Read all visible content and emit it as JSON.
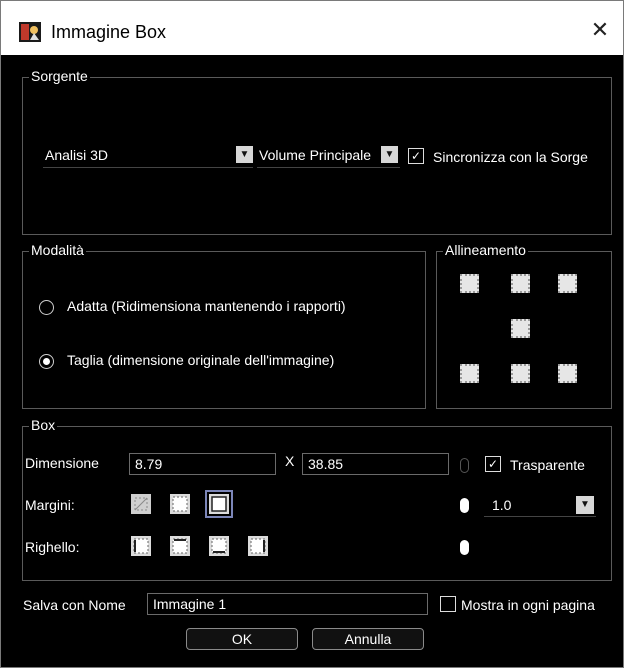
{
  "window": {
    "title": "Immagine Box",
    "close_symbol": "✕"
  },
  "sorgente": {
    "label": "Sorgente",
    "analysis_combo": "Analisi 3D",
    "volume_combo": "Volume Principale",
    "sync_checkbox": {
      "label": "Sincronizza con la Sorge",
      "checked": true
    }
  },
  "modalita": {
    "label": "Modalità",
    "options": [
      {
        "label": "Adatta (Ridimensiona mantenendo i rapporti)",
        "selected": false
      },
      {
        "label": "Taglia (dimensione originale dell'immagine)",
        "selected": true
      }
    ]
  },
  "allineamento": {
    "label": "Allineamento"
  },
  "box": {
    "label": "Box",
    "dimensione_label": "Dimensione",
    "width_value": "8.79",
    "x_separator": "X",
    "height_value": "38.85",
    "trasparente": {
      "label": "Trasparente",
      "checked": true
    },
    "margini_label": "Margini:",
    "righello_label": "Righello:",
    "opacity_value": "1.0"
  },
  "save": {
    "label": "Salva con Nome",
    "name_value": "Immagine 1",
    "every_page": {
      "label": "Mostra in ogni pagina",
      "checked": false
    }
  },
  "buttons": {
    "ok": "OK",
    "cancel": "Annulla"
  },
  "check_symbol": "✓",
  "arrow_symbol": "▼"
}
